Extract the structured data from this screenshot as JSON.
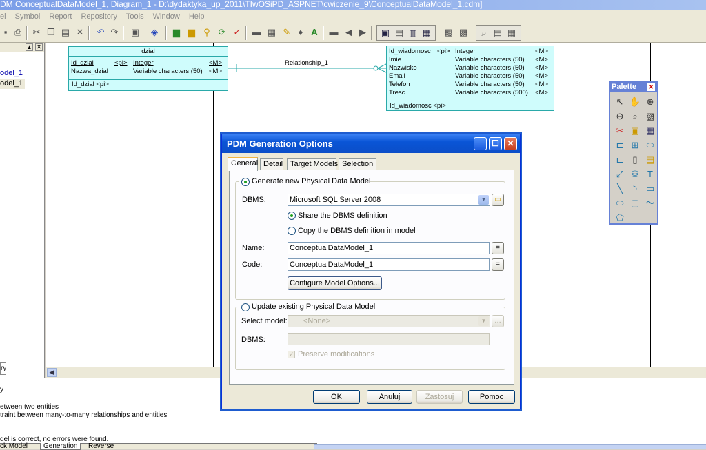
{
  "window": {
    "title": "DM ConceptualDataModel_1, Diagram_1 - D:\\dydaktyka_up_2011\\TIwOSiPD_ASPNET\\cwiczenie_9\\ConceptualDataModel_1.cdm]"
  },
  "menu": [
    "el",
    "Symbol",
    "Report",
    "Repository",
    "Tools",
    "Window",
    "Help"
  ],
  "tree": {
    "items": [
      "odel_1",
      "odel_1"
    ]
  },
  "diagram": {
    "entity_dzial": {
      "name": "dzial",
      "rows": [
        {
          "attr": "Id_dzial",
          "key": "<pi>",
          "type": "Integer",
          "m": "<M>"
        },
        {
          "attr": "Nazwa_dzial",
          "key": "",
          "type": "Variable characters (50)",
          "m": "<M>"
        }
      ],
      "identifier": "Id_dzial  <pi>"
    },
    "relationship": "Relationship_1",
    "entity_wiadomosc": {
      "rows": [
        {
          "attr": "Id_wiadomosc",
          "key": "<pi>",
          "type": "Integer",
          "m": "<M>"
        },
        {
          "attr": "Imie",
          "key": "",
          "type": "Variable characters (50)",
          "m": "<M>"
        },
        {
          "attr": "Nazwisko",
          "key": "",
          "type": "Variable characters (50)",
          "m": "<M>"
        },
        {
          "attr": "Email",
          "key": "",
          "type": "Variable characters (50)",
          "m": "<M>"
        },
        {
          "attr": "Telefon",
          "key": "",
          "type": "Variable characters (50)",
          "m": "<M>"
        },
        {
          "attr": "Tresc",
          "key": "",
          "type": "Variable characters (500)",
          "m": "<M>"
        }
      ],
      "identifier": "Id_wiadomosc  <pi>"
    }
  },
  "leftpane_bottom": "ry",
  "output": {
    "lines": [
      "y",
      "etween two entities",
      "traint between many-to-many relationships and entities",
      "del is correct, no errors were found."
    ],
    "tabs": [
      "ck Model",
      "Generation",
      "Reverse"
    ]
  },
  "palette": {
    "title": "Palette"
  },
  "dialog": {
    "title": "PDM Generation Options",
    "tabs": [
      "General",
      "Detail",
      "Target Models",
      "Selection"
    ],
    "generate_new": "Generate new Physical Data Model",
    "dbms_label": "DBMS:",
    "dbms_value": "Microsoft SQL Server 2008",
    "share_def": "Share the DBMS definition",
    "copy_def": "Copy the DBMS definition in model",
    "name_label": "Name:",
    "name_value": "ConceptualDataModel_1",
    "code_label": "Code:",
    "code_value": "ConceptualDataModel_1",
    "configure_btn": "Configure Model Options...",
    "update_existing": "Update existing Physical Data Model",
    "select_model_label": "Select model:",
    "select_model_value": "<None>",
    "dbms2_label": "DBMS:",
    "preserve": "Preserve modifications",
    "eq": "=",
    "buttons": {
      "ok": "OK",
      "cancel": "Anuluj",
      "apply": "Zastosuj",
      "help": "Pomoc"
    }
  }
}
